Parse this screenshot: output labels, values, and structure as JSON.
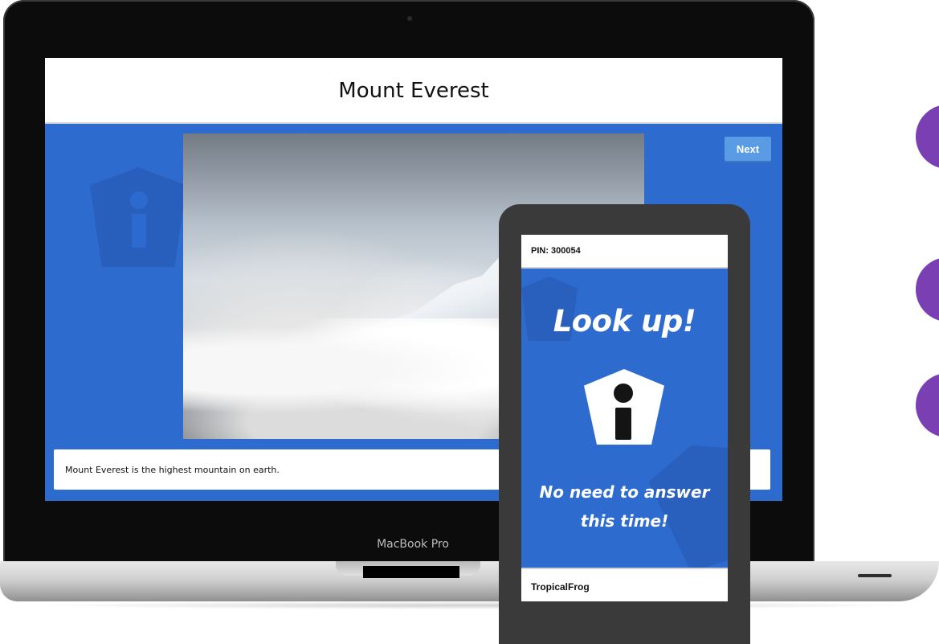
{
  "laptop": {
    "brand": "MacBook Pro",
    "screen": {
      "title": "Mount Everest",
      "next_label": "Next",
      "caption": "Mount Everest is the highest mountain on earth.",
      "image_alt": "Snow-covered mountain peak above clouds"
    }
  },
  "phone": {
    "pin": "PIN: 300054",
    "heading": "Look up!",
    "message_line1": "No need to answer",
    "message_line2": "this time!",
    "username": "TropicalFrog",
    "icon": "info-icon"
  },
  "colors": {
    "screen_blue": "#2d6bcf",
    "accent_purple": "#7a3fb3",
    "next_button": "#5a9be6"
  }
}
